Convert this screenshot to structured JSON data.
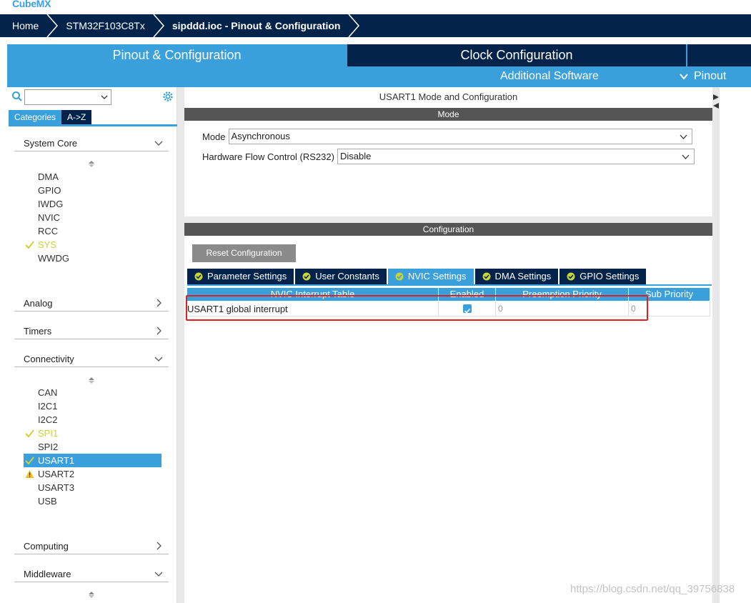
{
  "app": {
    "logo": "CubeMX"
  },
  "breadcrumb": [
    "Home",
    "STM32F103C8Tx",
    "sipddd.ioc - Pinout & Configuration"
  ],
  "topbar": {
    "tab_pinout": "Pinout & Configuration",
    "tab_clock": "Clock Configuration",
    "additional_software": "Additional Software",
    "pinout": "Pinout"
  },
  "sidebar": {
    "filter_tabs": [
      "Categories",
      "A->Z"
    ],
    "system_core": {
      "label": "System Core",
      "items": [
        "DMA",
        "GPIO",
        "IWDG",
        "NVIC",
        "RCC",
        "SYS",
        "WWDG"
      ]
    },
    "analog": "Analog",
    "timers": "Timers",
    "connectivity": {
      "label": "Connectivity",
      "items": [
        "CAN",
        "I2C1",
        "I2C2",
        "SPI1",
        "SPI2",
        "USART1",
        "USART2",
        "USART3",
        "USB"
      ]
    },
    "computing": "Computing",
    "middleware": "Middleware"
  },
  "main": {
    "title": "USART1 Mode and Configuration",
    "mode_section": "Mode",
    "mode_label": "Mode",
    "mode_value": "Asynchronous",
    "hfc_label": "Hardware Flow Control (RS232)",
    "hfc_value": "Disable",
    "config_section": "Configuration",
    "reset_button": "Reset Configuration",
    "tabs": [
      "Parameter Settings",
      "User Constants",
      "NVIC Settings",
      "DMA Settings",
      "GPIO Settings"
    ],
    "table": {
      "headers": [
        "NVIC Interrupt Table",
        "Enabled",
        "Preemption Priority",
        "Sub Priority"
      ],
      "row": {
        "name": "USART1 global interrupt",
        "preemption": "0",
        "sub": "0"
      }
    }
  },
  "watermark": "https://blog.csdn.net/qq_39756838",
  "colors": {
    "accent": "#3aa0dc",
    "navy": "#03234b",
    "check": "#c8d43a",
    "warning": "#f0c020",
    "highlight": "#e02020"
  }
}
